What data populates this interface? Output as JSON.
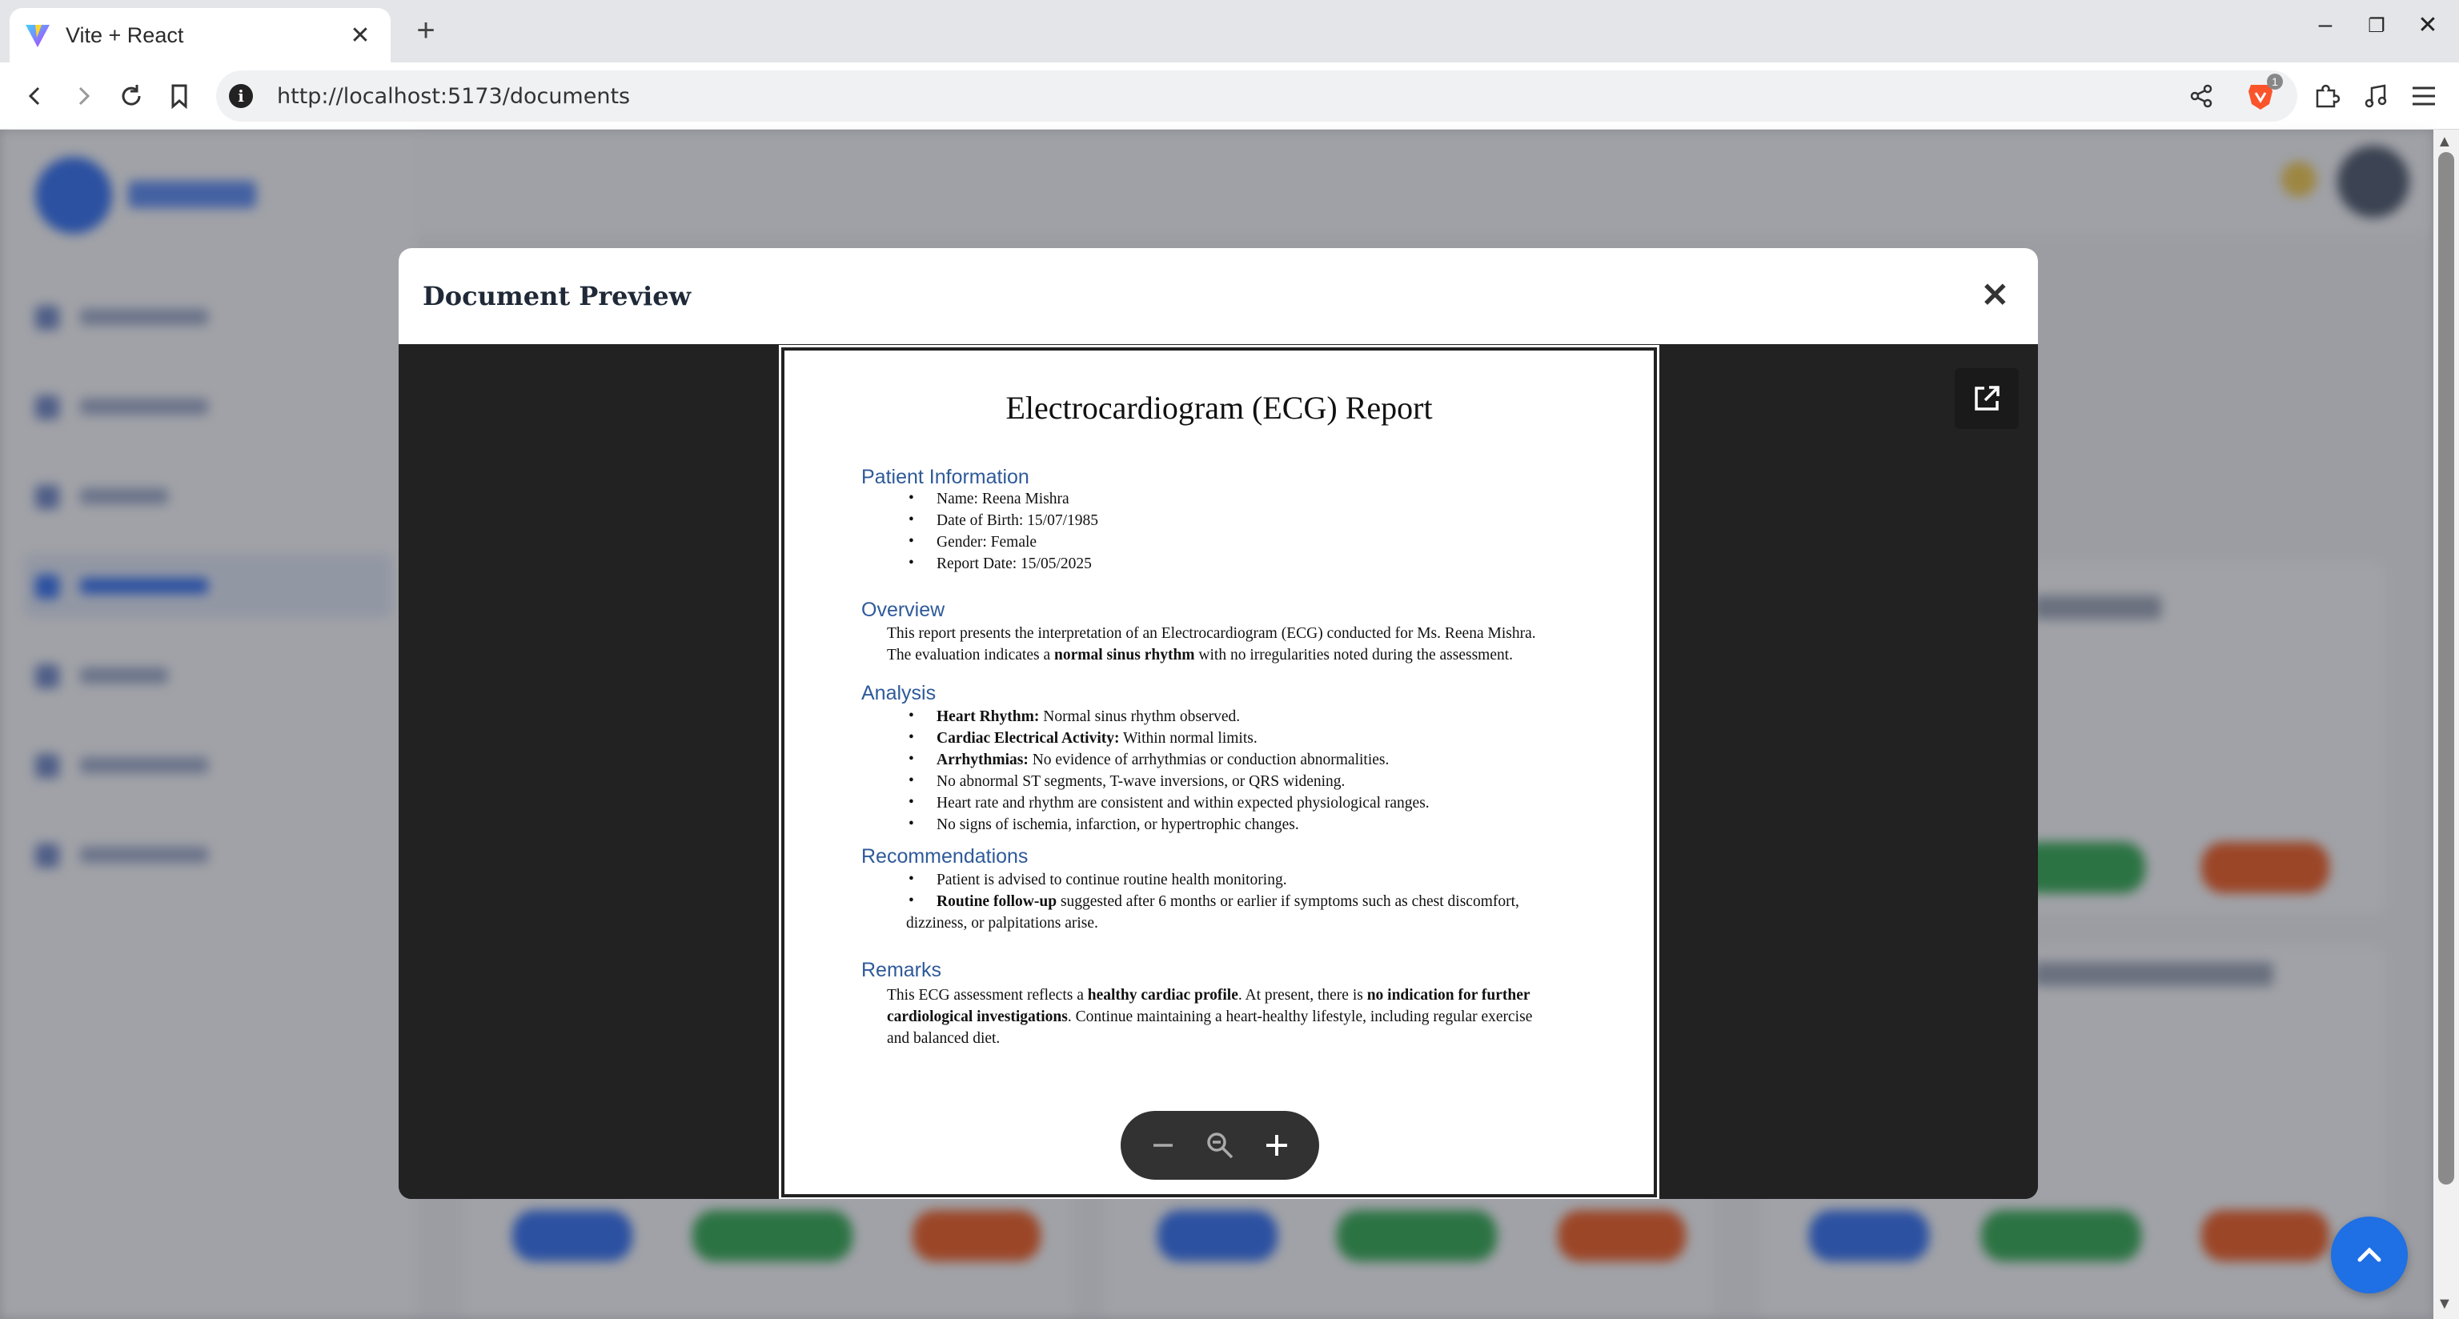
{
  "browser": {
    "tab_title": "Vite + React",
    "url": "http://localhost:5173/documents",
    "new_tab_glyph": "+",
    "close_glyph": "✕",
    "window_controls": [
      "–",
      "❐",
      "✕"
    ],
    "shield_badge": "1"
  },
  "modal": {
    "title": "Document Preview",
    "close_glyph": "✕"
  },
  "document": {
    "title": "Electrocardiogram (ECG) Report",
    "sections": {
      "patient_info": {
        "heading": "Patient Information",
        "items": [
          "Name: Reena Mishra",
          "Date of Birth: 15/07/1985",
          "Gender: Female",
          "Report Date: 15/05/2025"
        ]
      },
      "overview": {
        "heading": "Overview",
        "line1": "This report presents the interpretation of an Electrocardiogram (ECG) conducted for Ms. Reena Mishra.",
        "line2_pre": "The evaluation indicates a ",
        "line2_bold": "normal sinus rhythm",
        "line2_post": " with no irregularities noted during the assessment."
      },
      "analysis": {
        "heading": "Analysis",
        "items": [
          {
            "bold": "Heart Rhythm:",
            "text": " Normal sinus rhythm observed."
          },
          {
            "bold": "Cardiac Electrical Activity:",
            "text": " Within normal limits."
          },
          {
            "bold": "Arrhythmias:",
            "text": " No evidence of arrhythmias or conduction abnormalities."
          },
          {
            "bold": "",
            "text": "No abnormal ST segments, T-wave inversions, or QRS widening."
          },
          {
            "bold": "",
            "text": "Heart rate and rhythm are consistent and within expected physiological ranges."
          },
          {
            "bold": "",
            "text": "No signs of ischemia, infarction, or hypertrophic changes."
          }
        ]
      },
      "recommendations": {
        "heading": "Recommendations",
        "item1": "Patient is advised to continue routine health monitoring.",
        "item2_bold": "Routine follow-up",
        "item2_text": " suggested after 6 months or earlier if symptoms such as chest discomfort,",
        "item2_cont": "dizziness, or palpitations arise."
      },
      "remarks": {
        "heading": "Remarks",
        "l1_pre": "This ECG assessment reflects a ",
        "l1_bold": "healthy cardiac profile",
        "l1_mid": ". At present, there is ",
        "l1_bold2": "no indication for further",
        "l2_bold": "cardiological investigations",
        "l2_text": ". Continue maintaining a heart-healthy lifestyle, including regular exercise",
        "l3_text": "and balanced diet."
      }
    }
  },
  "colors": {
    "accent": "#2f6df0",
    "section_heading": "#2e5a9a",
    "fab": "#1f6fe5"
  }
}
